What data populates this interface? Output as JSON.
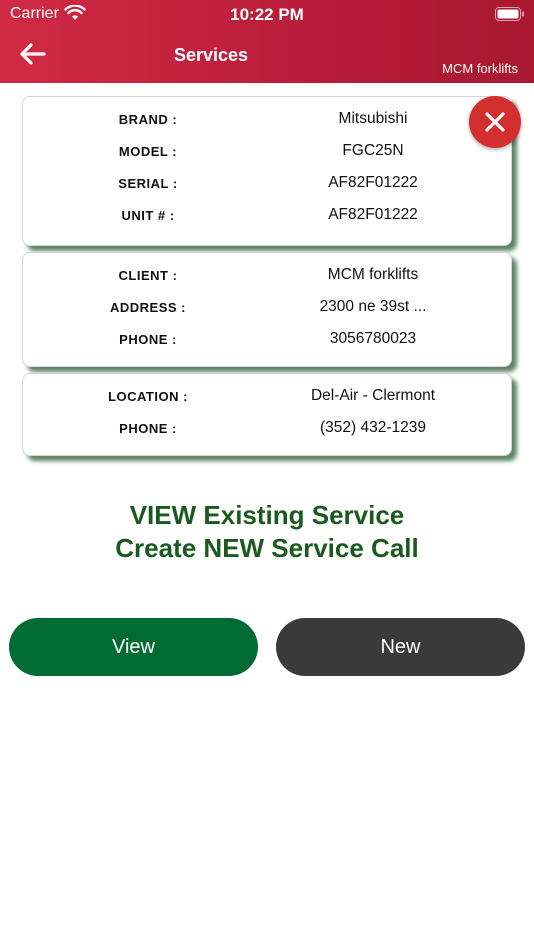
{
  "status_bar": {
    "carrier": "Carrier",
    "time": "10:22 PM"
  },
  "header": {
    "title": "Services",
    "company": "MCM forklifts"
  },
  "equipment": {
    "brand_label": "BRAND :",
    "brand": "Mitsubishi",
    "model_label": "MODEL :",
    "model": "FGC25N",
    "serial_label": "SERIAL :",
    "serial": "AF82F01222",
    "unit_label": "UNIT # :",
    "unit": "AF82F01222"
  },
  "client": {
    "client_label": "CLIENT :",
    "client": "MCM forklifts",
    "address_label": "ADDRESS :",
    "address": "2300 ne 39st ...",
    "phone_label": "PHONE :",
    "phone": "3056780023"
  },
  "location": {
    "location_label": "LOCATION :",
    "location": "Del-Air - Clermont",
    "phone_label": "PHONE :",
    "phone": "(352) 432-1239"
  },
  "prompt": {
    "line1": "VIEW Existing Service",
    "line2": "Create NEW Service Call"
  },
  "actions": {
    "view_label": "View",
    "new_label": "New"
  },
  "colors": {
    "header_red": "#c8213e",
    "close_red": "#d32f2f",
    "view_green": "#006b32",
    "new_gray": "#3a3a3a",
    "prompt_green": "#1a5a1f"
  },
  "icons": {
    "back": "arrow-left-icon",
    "close": "close-icon",
    "wifi": "wifi-icon",
    "battery": "battery-icon"
  }
}
